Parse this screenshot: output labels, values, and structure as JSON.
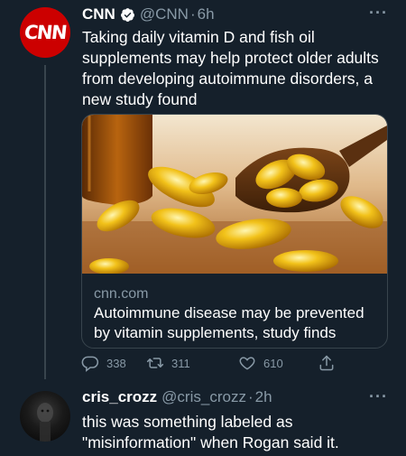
{
  "tweet": {
    "avatar_text": "CNN",
    "author_name": "CNN",
    "handle": "@CNN",
    "separator": "·",
    "time": "6h",
    "more": "···",
    "text": "Taking daily vitamin D and fish oil supplements may help protect older adults from developing autoimmune disorders, a new study found",
    "card": {
      "domain": "cnn.com",
      "title": "Autoimmune disease may be prevented by vitamin supplements, study finds"
    },
    "actions": {
      "replies": "338",
      "retweets": "311",
      "likes": "610"
    }
  },
  "reply": {
    "author_name": "cris_crozz",
    "handle": "@cris_crozz",
    "separator": "·",
    "time": "2h",
    "more": "···",
    "text": "this was something labeled as \"misinformation\" when Rogan said it."
  },
  "colors": {
    "background": "#15202b",
    "secondary_text": "#8899a6",
    "border": "#38444d",
    "cnn_red": "#cc0000",
    "verified_blue": "#ffffff"
  }
}
